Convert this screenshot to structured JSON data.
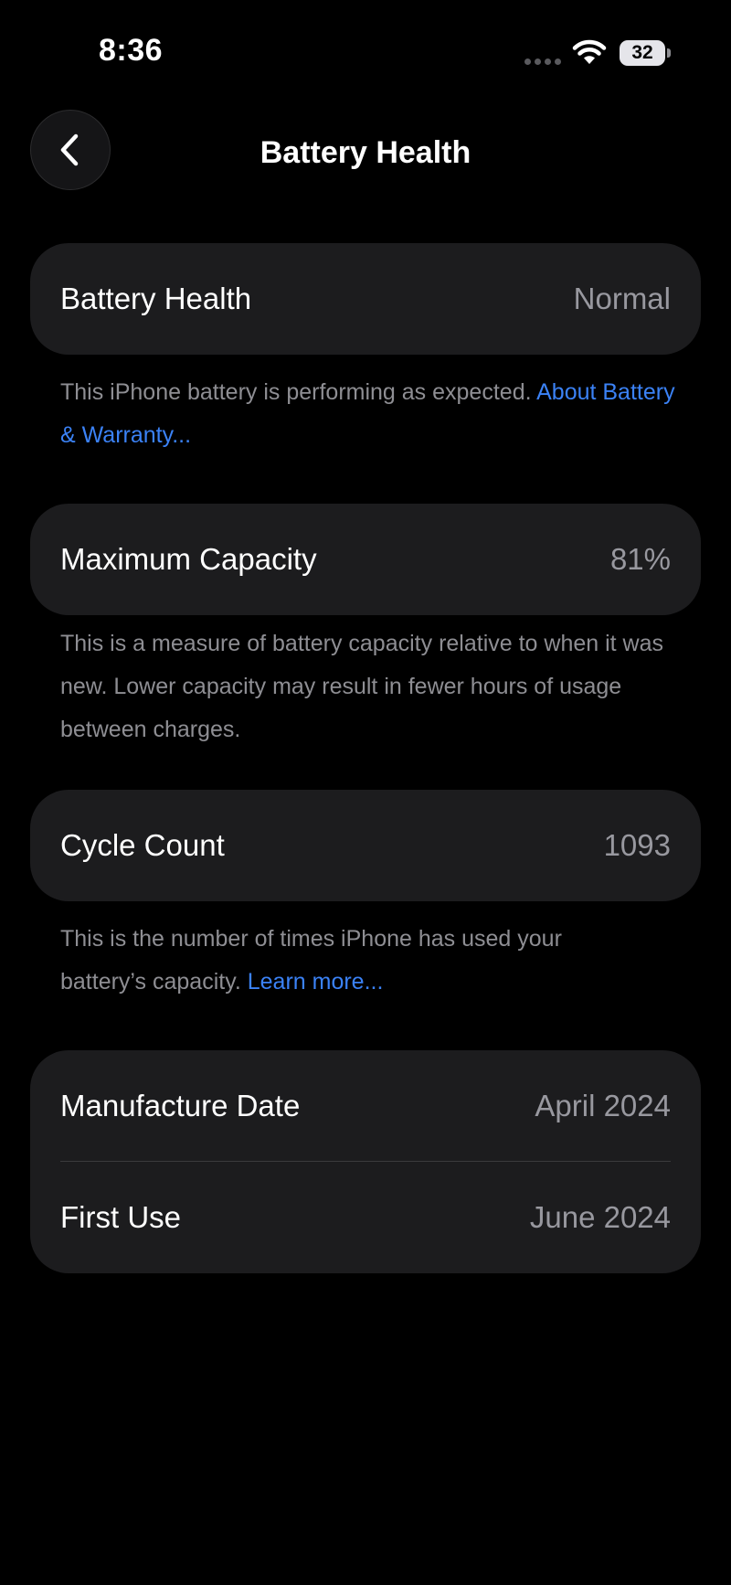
{
  "status_bar": {
    "time": "8:36",
    "battery_level": "32",
    "icons": [
      "signal-dots-icon",
      "wifi-icon",
      "battery-icon"
    ]
  },
  "nav": {
    "back_icon": "chevron-left-icon",
    "title": "Battery Health"
  },
  "sections": {
    "health": {
      "label": "Battery Health",
      "value": "Normal",
      "footnote_text": "This iPhone battery is performing as expected. ",
      "footnote_link": "About Battery & Warranty..."
    },
    "capacity": {
      "label": "Maximum Capacity",
      "value": "81%",
      "footnote_text": "This is a measure of battery capacity relative to when it was new. Lower capacity may result in fewer hours of usage between charges."
    },
    "cycles": {
      "label": "Cycle Count",
      "value": "1093",
      "footnote_text": "This is the number of times iPhone has used your battery’s capacity. ",
      "footnote_link": "Learn more..."
    },
    "dates": {
      "manufacture_label": "Manufacture Date",
      "manufacture_value": "April 2024",
      "first_use_label": "First Use",
      "first_use_value": "June 2024"
    }
  },
  "colors": {
    "background": "#000000",
    "card": "#1c1c1e",
    "secondary_text": "#98989f",
    "footnote_text": "#8e8e93",
    "link": "#3b82f6"
  }
}
